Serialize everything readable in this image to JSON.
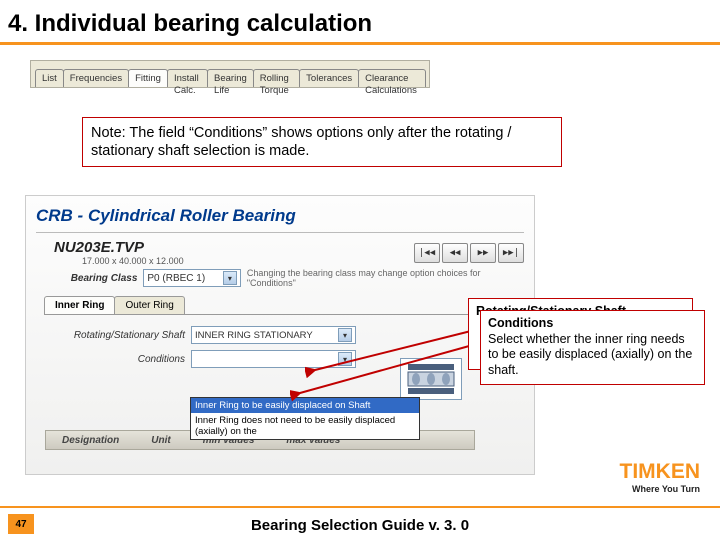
{
  "title": "4. Individual bearing calculation",
  "top_tabs": [
    "List",
    "Frequencies",
    "Fitting",
    "Install Calc.",
    "Bearing Life",
    "Rolling Torque",
    "Tolerances",
    "Clearance Calculations"
  ],
  "top_tabs_active_index": 2,
  "note": "Note: The field “Conditions” shows options only after the rotating / stationary shaft selection is made.",
  "app": {
    "heading": "CRB - Cylindrical Roller Bearing",
    "designation": "NU203E.TVP",
    "dimensions": "17.000 x 40.000 x 12.000",
    "nav": [
      "|◀◀",
      "◀◀",
      "▶▶",
      "▶▶|"
    ],
    "bearing_class_label": "Bearing Class",
    "bearing_class_value": "P0 (RBEC 1)",
    "bearing_class_info": "Changing the bearing class may change option choices for \"Conditions\"",
    "subtabs": [
      "Inner Ring",
      "Outer Ring"
    ],
    "subtabs_active_index": 0,
    "rot_label": "Rotating/Stationary Shaft",
    "rot_value": "INNER RING STATIONARY",
    "cond_label": "Conditions",
    "cond_value": "",
    "dropdown_options": [
      "Inner Ring to be easily displaced on Shaft",
      "Inner Ring does not need to be easily displaced (axially) on the"
    ],
    "greybar": {
      "c1": "Designation",
      "c2": "Unit",
      "c3": "min values",
      "c4": "max values"
    }
  },
  "callout_back_heading": "Rotating/Stationary Shaft",
  "callout": {
    "heading": "Conditions",
    "body": "Select whether the inner ring needs to be easily displaced (axially) on the shaft."
  },
  "logo": {
    "brand": "TIMKEN",
    "tag": "Where You Turn"
  },
  "footer": "Bearing Selection Guide v. 3. 0",
  "page": "47"
}
